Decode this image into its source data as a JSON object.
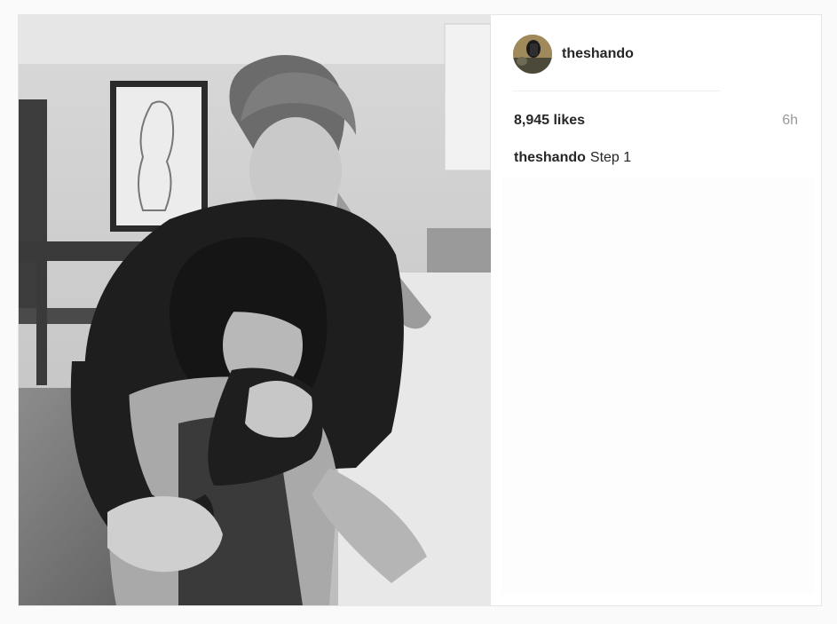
{
  "post": {
    "username": "theshando",
    "likes": "8,945 likes",
    "time": "6h",
    "caption_user": "theshando",
    "caption_text": "Step 1"
  },
  "icons": {
    "avatar": "profile-avatar"
  }
}
